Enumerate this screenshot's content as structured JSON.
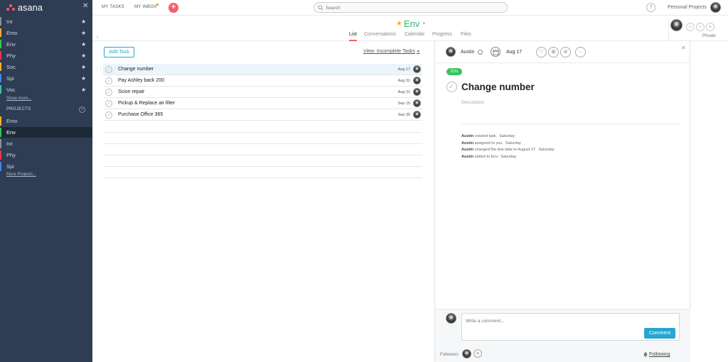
{
  "sidebar": {
    "logo_text": "asana",
    "favorites": [
      {
        "label": "Int",
        "color": "#8a8f99"
      },
      {
        "label": "Emo",
        "color": "#f2b02b"
      },
      {
        "label": "Env",
        "color": "#37c55a"
      },
      {
        "label": "Phy",
        "color": "#e8384f"
      },
      {
        "label": "Soc",
        "color": "#f2b02b"
      },
      {
        "label": "Spi",
        "color": "#4186e0"
      },
      {
        "label": "Voc",
        "color": "#37c5ab"
      }
    ],
    "show_more": "Show more...",
    "projects_heading": "PROJECTS",
    "projects": [
      {
        "label": "Emo",
        "color": "#f2b02b",
        "active": false
      },
      {
        "label": "Env",
        "color": "#37c55a",
        "active": true
      },
      {
        "label": "Int",
        "color": "#8a8f99",
        "active": false
      },
      {
        "label": "Phy",
        "color": "#e8384f",
        "active": false
      },
      {
        "label": "Spi",
        "color": "#4186e0",
        "active": false
      }
    ],
    "more_projects": "More Projects..."
  },
  "topbar": {
    "my_tasks": "MY TASKS",
    "my_inbox": "MY INBOX",
    "search_placeholder": "Search",
    "help": "?",
    "org_name": "Personal Projects"
  },
  "project": {
    "name": "Env",
    "tabs": [
      "List",
      "Conversations",
      "Calendar",
      "Progress",
      "Files"
    ],
    "active_tab": "List",
    "privacy": "Private"
  },
  "list": {
    "add_task": "Add Task",
    "view_filter": "View: Incomplete Tasks",
    "tasks": [
      {
        "name": "Change number",
        "due": "Aug 17",
        "selected": true
      },
      {
        "name": "Pay Ashley back 200",
        "due": "Aug 31",
        "selected": false
      },
      {
        "name": "Scion repair",
        "due": "Aug 31",
        "selected": false
      },
      {
        "name": "Pickup & Replace air filter",
        "due": "Sep 15",
        "selected": false
      },
      {
        "name": "Purchase Office 365",
        "due": "Sep 30",
        "selected": false
      }
    ]
  },
  "detail": {
    "assignee": "Austin",
    "due_date": "Aug 17",
    "tag": "Env",
    "title": "Change number",
    "description_placeholder": "Description",
    "stories": [
      {
        "actor": "Austin",
        "text": "created task.",
        "time": "Saturday"
      },
      {
        "actor": "Austin",
        "text": "assigned to you.",
        "time": "Saturday"
      },
      {
        "actor": "Austin",
        "text": "changed the due date to August 17.",
        "time": "Saturday"
      },
      {
        "actor": "Austin",
        "text": "added to Env.",
        "time": "Saturday"
      }
    ],
    "comment_placeholder": "Write a comment...",
    "comment_button": "Comment",
    "followers_label": "Followers",
    "following_label": "Following"
  },
  "colors": {
    "sidebar_bg": "#2e3c54",
    "accent_blue": "#26a6d1",
    "brand_coral": "#f95d6a",
    "project_green": "#37c55a"
  }
}
